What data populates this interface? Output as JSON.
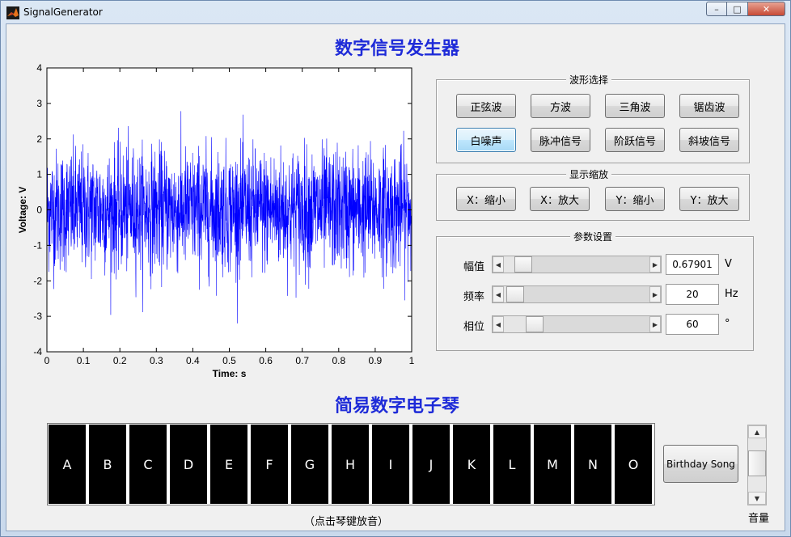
{
  "window": {
    "title": "SignalGenerator",
    "min_icon": "minimize-icon",
    "max_icon": "maximize-icon",
    "close_icon": "close-icon",
    "close_glyph": "✕",
    "max_glyph": "□",
    "min_glyph": "–"
  },
  "heading_top": "数字信号发生器",
  "heading_bottom": "简易数字电子琴",
  "chart_data": {
    "type": "line",
    "xlabel": "Time: s",
    "ylabel": "Voltage: V",
    "xlim": [
      0,
      1
    ],
    "ylim": [
      -4,
      4
    ],
    "xticks": [
      "0",
      "0.1",
      "0.2",
      "0.3",
      "0.4",
      "0.5",
      "0.6",
      "0.7",
      "0.8",
      "0.9",
      "1"
    ],
    "yticks": [
      "4",
      "3",
      "2",
      "1",
      "0",
      "-1",
      "-2",
      "-3",
      "-4"
    ],
    "series_color": "#0000ff",
    "signal": "white noise",
    "sample_rate_hz": 2000,
    "approx_envelope": [
      -3.2,
      3.2
    ],
    "grid": false
  },
  "waveform_panel": {
    "title": "波形选择",
    "buttons": [
      "正弦波",
      "方波",
      "三角波",
      "锯齿波",
      "白噪声",
      "脉冲信号",
      "阶跃信号",
      "斜坡信号"
    ],
    "active_index": 4
  },
  "zoom_panel": {
    "title": "显示缩放",
    "buttons": [
      "X：缩小",
      "X：放大",
      "Y：缩小",
      "Y：放大"
    ]
  },
  "params_panel": {
    "title": "参数设置",
    "rows": [
      {
        "label": "幅值",
        "value": "0.67901",
        "unit": "V",
        "fraction": 0.08
      },
      {
        "label": "频率",
        "value": "20",
        "unit": "Hz",
        "fraction": 0.02
      },
      {
        "label": "相位",
        "value": "60",
        "unit": "°",
        "fraction": 0.17
      }
    ]
  },
  "piano": {
    "keys": [
      "A",
      "B",
      "C",
      "D",
      "E",
      "F",
      "G",
      "H",
      "I",
      "J",
      "K",
      "L",
      "M",
      "N",
      "O"
    ],
    "hint": "（点击琴键放音）",
    "song_button": "Birthday Song",
    "volume_label": "音量",
    "volume_fraction": 0.45
  }
}
